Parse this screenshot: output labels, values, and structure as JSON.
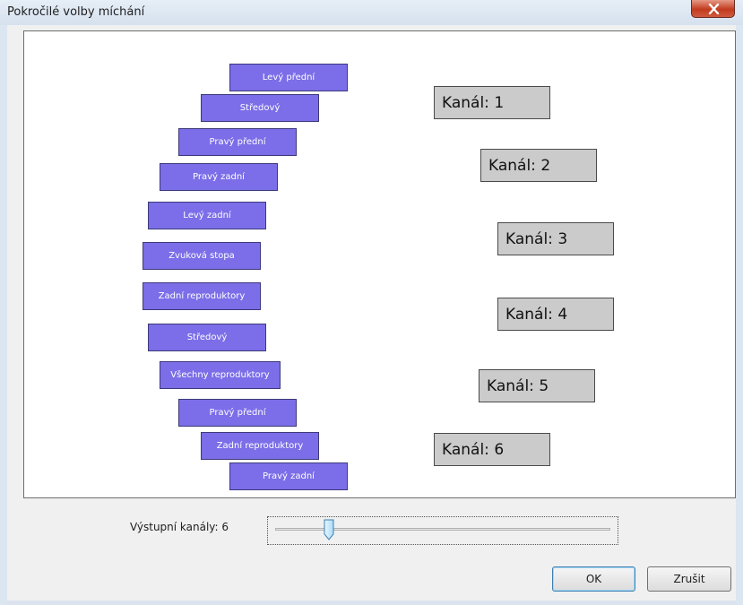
{
  "window": {
    "title": "Pokročilé volby míchání"
  },
  "speakers": [
    {
      "label": "Levý přední"
    },
    {
      "label": "Středový"
    },
    {
      "label": "Pravý přední"
    },
    {
      "label": "Pravý zadní"
    },
    {
      "label": "Levý zadní"
    },
    {
      "label": "Zvuková stopa"
    },
    {
      "label": "Zadní reproduktory"
    },
    {
      "label": "Středový"
    },
    {
      "label": "Všechny reproduktory"
    },
    {
      "label": "Pravý přední"
    },
    {
      "label": "Zadní reproduktory"
    },
    {
      "label": "Pravý zadní"
    }
  ],
  "channels": [
    {
      "label": "Kanál:  1"
    },
    {
      "label": "Kanál:  2"
    },
    {
      "label": "Kanál:  3"
    },
    {
      "label": "Kanál:  4"
    },
    {
      "label": "Kanál:  5"
    },
    {
      "label": "Kanál:  6"
    }
  ],
  "output": {
    "label": "Výstupní kanály:  6",
    "slider_value": 6
  },
  "buttons": {
    "ok": "OK",
    "cancel": "Zrušit"
  },
  "colors": {
    "speaker_fill": "#7b6ee8",
    "channel_fill": "#cbcbcb"
  }
}
